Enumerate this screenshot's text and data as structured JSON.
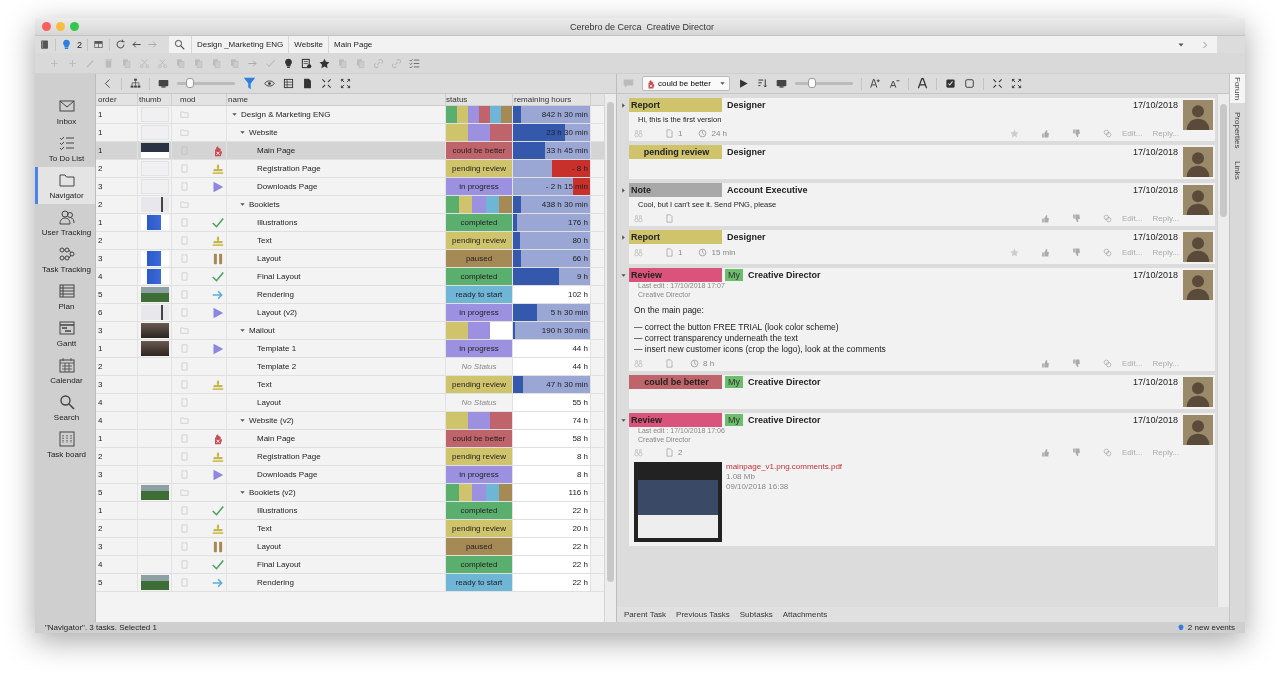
{
  "window": {
    "app": "Cerebro de Cerca",
    "user": "Creative Director"
  },
  "toolbar": {
    "notifications": "2",
    "breadcrumbs": [
      {
        "label": "Design _Marketing ENG"
      },
      {
        "label": "Website"
      },
      {
        "label": "Main Page"
      }
    ]
  },
  "sidebar": {
    "items": [
      {
        "label": "Inbox",
        "selected": false
      },
      {
        "label": "To Do List",
        "selected": false
      },
      {
        "label": "Navigator",
        "selected": true
      },
      {
        "label": "User Tracking",
        "selected": false
      },
      {
        "label": "Task Tracking",
        "selected": false
      },
      {
        "label": "Plan",
        "selected": false
      },
      {
        "label": "Gantt",
        "selected": false
      },
      {
        "label": "Calendar",
        "selected": false
      },
      {
        "label": "Search",
        "selected": false
      },
      {
        "label": "Task board",
        "selected": false
      }
    ]
  },
  "tree": {
    "zoom": {
      "level": 0.22
    },
    "columns": [
      "order",
      "thumb",
      "mod",
      "name",
      "status",
      "remaining hours"
    ],
    "rows": [
      {
        "order": "1",
        "thumb": {
          "kind": "light"
        },
        "name": "Design & Marketing ENG",
        "expanded": true,
        "selected": false,
        "segments": [
          {
            "color": "#5aae6e"
          },
          {
            "color": "#cfc46b"
          },
          {
            "color": "#9b91e0"
          },
          {
            "color": "#c0646b"
          },
          {
            "color": "#6fb5d6"
          },
          {
            "color": "#a68a55"
          }
        ],
        "remaining": {
          "text": "842 h 30 min",
          "kind": "bar",
          "level": 0.1
        },
        "children": [
          {
            "order": "1",
            "thumb": {
              "kind": "light"
            },
            "name": "Website",
            "expanded": true,
            "selected": false,
            "segments": [
              {
                "color": "#cfc46b"
              },
              {
                "color": "#9b91e0"
              },
              {
                "color": "#c0646b"
              }
            ],
            "remaining": {
              "text": "23 h 30 min",
              "kind": "bar",
              "level": 0.68
            },
            "children": [
              {
                "order": "1",
                "thumb": {
                  "kind": "dark"
                },
                "name": "Main Page",
                "selected": true,
                "status": {
                  "label": "could be better",
                  "color": "#c0646b",
                  "kind": "reject"
                },
                "remaining": {
                  "text": "33 h 45 min",
                  "kind": "bar",
                  "level": 0.42
                }
              },
              {
                "order": "2",
                "thumb": {
                  "kind": "light"
                },
                "name": "Registration Page",
                "selected": false,
                "status": {
                  "label": "pending review",
                  "color": "#cfc46b",
                  "kind": "review"
                },
                "remaining": {
                  "text": "- 8 h",
                  "kind": "overdue",
                  "level": 0.5
                }
              },
              {
                "order": "3",
                "thumb": {
                  "kind": "light"
                },
                "name": "Downloads Page",
                "selected": false,
                "status": {
                  "label": "in progress",
                  "color": "#9b91e0",
                  "kind": "progress"
                },
                "remaining": {
                  "text": "- 2 h 15 min",
                  "kind": "overdue",
                  "level": 0.22
                }
              }
            ]
          },
          {
            "order": "2",
            "thumb": {
              "kind": "chart"
            },
            "name": "Booklets",
            "expanded": true,
            "selected": false,
            "segments": [
              {
                "color": "#5aae6e"
              },
              {
                "color": "#cfc46b"
              },
              {
                "color": "#9b91e0"
              },
              {
                "color": "#6fb5d6"
              },
              {
                "color": "#a68a55"
              }
            ],
            "remaining": {
              "text": "438 h 30 min",
              "kind": "bar",
              "level": 0.1
            },
            "children": [
              {
                "order": "1",
                "thumb": {
                  "kind": "blue"
                },
                "name": "Illustrations",
                "selected": false,
                "status": {
                  "label": "completed",
                  "color": "#5aae6e",
                  "kind": "done"
                },
                "remaining": {
                  "text": "176 h",
                  "kind": "bar",
                  "level": 0.05
                }
              },
              {
                "order": "2",
                "name": "Text",
                "selected": false,
                "status": {
                  "label": "pending review",
                  "color": "#cfc46b",
                  "kind": "review"
                },
                "remaining": {
                  "text": "80 h",
                  "kind": "bar",
                  "level": 0.09
                }
              },
              {
                "order": "3",
                "thumb": {
                  "kind": "blue"
                },
                "name": "Layout",
                "selected": false,
                "status": {
                  "label": "paused",
                  "color": "#a68a55",
                  "kind": "paused"
                },
                "remaining": {
                  "text": "66 h",
                  "kind": "bar",
                  "level": 0.11
                }
              },
              {
                "order": "4",
                "thumb": {
                  "kind": "blue"
                },
                "name": "Final Layout",
                "selected": false,
                "status": {
                  "label": "completed",
                  "color": "#5aae6e",
                  "kind": "done"
                },
                "remaining": {
                  "text": "9 h",
                  "kind": "bar",
                  "level": 0.6
                }
              },
              {
                "order": "5",
                "thumb": {
                  "kind": "green"
                },
                "name": "Rendering",
                "selected": false,
                "status": {
                  "label": "ready to start",
                  "color": "#6fb5d6",
                  "kind": "ready"
                },
                "remaining": {
                  "text": "102 h",
                  "kind": "plain"
                }
              },
              {
                "order": "6",
                "thumb": {
                  "kind": "chart"
                },
                "name": "Layout (v2)",
                "selected": false,
                "status": {
                  "label": "in progress",
                  "color": "#9b91e0",
                  "kind": "progress"
                },
                "remaining": {
                  "text": "5 h 30 min",
                  "kind": "bar",
                  "level": 0.31
                }
              }
            ]
          },
          {
            "order": "3",
            "thumb": {
              "kind": "sunset"
            },
            "name": "Mailout",
            "expanded": true,
            "selected": false,
            "segments": [
              {
                "color": "#cfc46b"
              },
              {
                "color": "#9b91e0"
              },
              {
                "color": "#ffffff"
              }
            ],
            "remaining": {
              "text": "190 h 30 min",
              "kind": "bar",
              "level": 0.03
            },
            "children": [
              {
                "order": "1",
                "thumb": {
                  "kind": "sunset"
                },
                "name": "Template 1",
                "selected": false,
                "status": {
                  "label": "in progress",
                  "color": "#9b91e0",
                  "kind": "progress"
                },
                "remaining": {
                  "text": "44 h",
                  "kind": "plain"
                }
              },
              {
                "order": "2",
                "name": "Template 2",
                "selected": false,
                "status": {
                  "label": "No Status",
                  "kind": "none"
                },
                "remaining": {
                  "text": "44 h",
                  "kind": "plain"
                }
              },
              {
                "order": "3",
                "name": "Text",
                "selected": false,
                "status": {
                  "label": "pending review",
                  "color": "#cfc46b",
                  "kind": "review"
                },
                "remaining": {
                  "text": "47 h 30 min",
                  "kind": "bar",
                  "level": 0.13
                }
              },
              {
                "order": "4",
                "name": "Layout",
                "selected": false,
                "status": {
                  "label": "No Status",
                  "kind": "none"
                },
                "remaining": {
                  "text": "55 h",
                  "kind": "plain"
                }
              }
            ]
          },
          {
            "order": "4",
            "name": "Website (v2)",
            "expanded": true,
            "selected": false,
            "segments": [
              {
                "color": "#cfc46b"
              },
              {
                "color": "#9b91e0"
              },
              {
                "color": "#c0646b"
              }
            ],
            "remaining": {
              "text": "74 h",
              "kind": "plain"
            },
            "children": [
              {
                "order": "1",
                "name": "Main Page",
                "selected": false,
                "status": {
                  "label": "could be better",
                  "color": "#c0646b",
                  "kind": "reject"
                },
                "remaining": {
                  "text": "58 h",
                  "kind": "plain"
                }
              },
              {
                "order": "2",
                "name": "Registration Page",
                "selected": false,
                "status": {
                  "label": "pending review",
                  "color": "#cfc46b",
                  "kind": "review"
                },
                "remaining": {
                  "text": "8 h",
                  "kind": "plain"
                }
              },
              {
                "order": "3",
                "name": "Downloads Page",
                "selected": false,
                "status": {
                  "label": "in progress",
                  "color": "#9b91e0",
                  "kind": "progress"
                },
                "remaining": {
                  "text": "8 h",
                  "kind": "plain"
                }
              }
            ]
          },
          {
            "order": "5",
            "thumb": {
              "kind": "green"
            },
            "name": "Booklets (v2)",
            "expanded": true,
            "selected": false,
            "segments": [
              {
                "color": "#5aae6e"
              },
              {
                "color": "#cfc46b"
              },
              {
                "color": "#9b91e0"
              },
              {
                "color": "#6fb5d6"
              },
              {
                "color": "#a68a55"
              }
            ],
            "remaining": {
              "text": "116 h",
              "kind": "plain"
            },
            "children": [
              {
                "order": "1",
                "name": "Illustrations",
                "selected": false,
                "status": {
                  "label": "completed",
                  "color": "#5aae6e",
                  "kind": "done"
                },
                "remaining": {
                  "text": "22 h",
                  "kind": "plain"
                }
              },
              {
                "order": "2",
                "name": "Text",
                "selected": false,
                "status": {
                  "label": "pending review",
                  "color": "#cfc46b",
                  "kind": "review"
                },
                "remaining": {
                  "text": "20 h",
                  "kind": "plain"
                }
              },
              {
                "order": "3",
                "name": "Layout",
                "selected": false,
                "status": {
                  "label": "paused",
                  "color": "#a68a55",
                  "kind": "paused"
                },
                "remaining": {
                  "text": "22 h",
                  "kind": "plain"
                }
              },
              {
                "order": "4",
                "name": "Final Layout",
                "selected": false,
                "status": {
                  "label": "completed",
                  "color": "#5aae6e",
                  "kind": "done"
                },
                "remaining": {
                  "text": "22 h",
                  "kind": "plain"
                }
              },
              {
                "order": "5",
                "thumb": {
                  "kind": "green"
                },
                "name": "Rendering",
                "selected": false,
                "status": {
                  "label": "ready to start",
                  "color": "#6fb5d6",
                  "kind": "ready"
                },
                "remaining": {
                  "text": "22 h",
                  "kind": "plain"
                }
              }
            ]
          }
        ]
      }
    ]
  },
  "forum": {
    "filter": "could be better",
    "size": {
      "level": 0.3
    },
    "posts": [
      {
        "kind": "message",
        "type": "Report",
        "color": "#cfc46b",
        "expanded": false,
        "author": "Designer",
        "date": "17/10/2018",
        "body": [
          "Hi, this is the first version"
        ],
        "footer": {
          "files": "1",
          "time": "24 h",
          "star": true,
          "edit": "Edit...",
          "reply": "Reply..."
        }
      },
      {
        "kind": "status",
        "type": "pending review",
        "color": "#cfc46b",
        "author": "Designer",
        "date": "17/10/2018"
      },
      {
        "kind": "message",
        "type": "Note",
        "color": "#a8a8a8",
        "expanded": false,
        "author": "Account Executive",
        "date": "17/10/2018",
        "body": [
          "Cool, but I can't see it. Send PNG, please"
        ],
        "footer": {
          "edit": "Edit...",
          "reply": "Reply..."
        }
      },
      {
        "kind": "message",
        "type": "Report",
        "color": "#cfc46b",
        "expanded": false,
        "author": "Designer",
        "date": "17/10/2018",
        "footer": {
          "files": "1",
          "time": "15 min",
          "star": true,
          "edit": "Edit...",
          "reply": "Reply..."
        }
      },
      {
        "kind": "message",
        "type": "Review",
        "color": "#d9537a",
        "expanded": true,
        "my_label": "My",
        "author": "Creative Director",
        "date": "17/10/2018",
        "edited": "Last edit : 17/10/2018 17:07",
        "editor": "Creative Director",
        "body": [
          "On the main page:",
          "— correct the button FREE TRIAL (look color scheme)",
          "— correct transparency underneath the text",
          "— insert new customer icons (crop the logo), look at the comments"
        ],
        "footer": {
          "time": "8 h",
          "edit": "Edit...",
          "reply": "Reply..."
        }
      },
      {
        "kind": "status",
        "type": "could be better",
        "color": "#c0646b",
        "my_label": "My",
        "author": "Creative Director",
        "date": "17/10/2018"
      },
      {
        "kind": "message",
        "type": "Review",
        "color": "#d9537a",
        "expanded": true,
        "my_label": "My",
        "author": "Creative Director",
        "date": "17/10/2018",
        "edited": "Last edit : 17/10/2018 17:06",
        "editor": "Creative Director",
        "footer": {
          "files": "2",
          "edit": "Edit...",
          "reply": "Reply..."
        },
        "attachment": {
          "name": "mainpage_v1.png.comments.pdf",
          "size": "1.08 Mb",
          "date": "09/10/2018 16:38"
        }
      }
    ],
    "tabs": [
      {
        "label": "Parent Task"
      },
      {
        "label": "Previous Tasks"
      },
      {
        "label": "Subtasks"
      },
      {
        "label": "Attachments"
      }
    ],
    "side_tabs": [
      {
        "label": "Forum",
        "selected": true
      },
      {
        "label": "Properties",
        "selected": false
      },
      {
        "label": "Links",
        "selected": false
      }
    ]
  },
  "status_bar": {
    "text": "\"Navigator\". 3 tasks. Selected 1",
    "events": "2 new events"
  }
}
